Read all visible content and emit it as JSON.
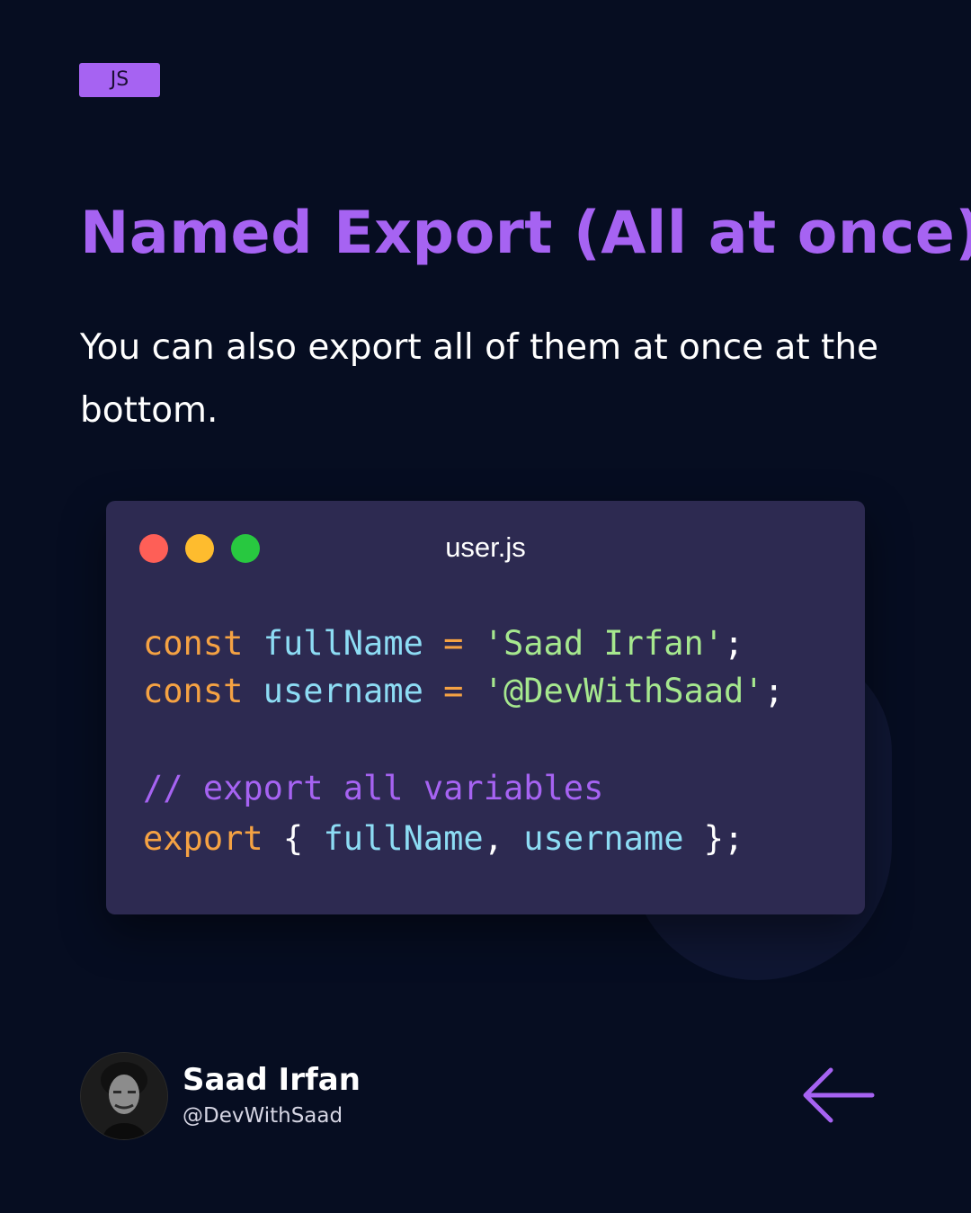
{
  "tag": {
    "label": "JS"
  },
  "title": "Named Export (All at once)",
  "description": "You can also export all of them at once at the bottom.",
  "code_window": {
    "filename": "user.js",
    "lines": [
      [
        {
          "t": "const",
          "c": "kw"
        },
        {
          "t": " ",
          "c": "punc"
        },
        {
          "t": "fullName",
          "c": "ident"
        },
        {
          "t": " = ",
          "c": "op"
        },
        {
          "t": "'Saad Irfan'",
          "c": "str"
        },
        {
          "t": ";",
          "c": "punc"
        }
      ],
      [
        {
          "t": "const",
          "c": "kw"
        },
        {
          "t": " ",
          "c": "punc"
        },
        {
          "t": "username",
          "c": "ident"
        },
        {
          "t": " = ",
          "c": "op"
        },
        {
          "t": "'@DevWithSaad'",
          "c": "str"
        },
        {
          "t": ";",
          "c": "punc"
        }
      ],
      [],
      [
        {
          "t": "// export all variables",
          "c": "comment"
        }
      ],
      [
        {
          "t": "export",
          "c": "kw"
        },
        {
          "t": " { ",
          "c": "punc"
        },
        {
          "t": "fullName",
          "c": "ident"
        },
        {
          "t": ", ",
          "c": "punc"
        },
        {
          "t": "username",
          "c": "ident"
        },
        {
          "t": " };",
          "c": "punc"
        }
      ]
    ]
  },
  "author": {
    "name": "Saad Irfan",
    "handle": "@DevWithSaad"
  },
  "colors": {
    "background": "#060d21",
    "accent": "#a663f2",
    "window": "#2d2a51",
    "keyword": "#f5a243",
    "identifier": "#8ddcf4",
    "string": "#a6e88e"
  },
  "icons": {
    "nav": "arrow-left-icon"
  }
}
